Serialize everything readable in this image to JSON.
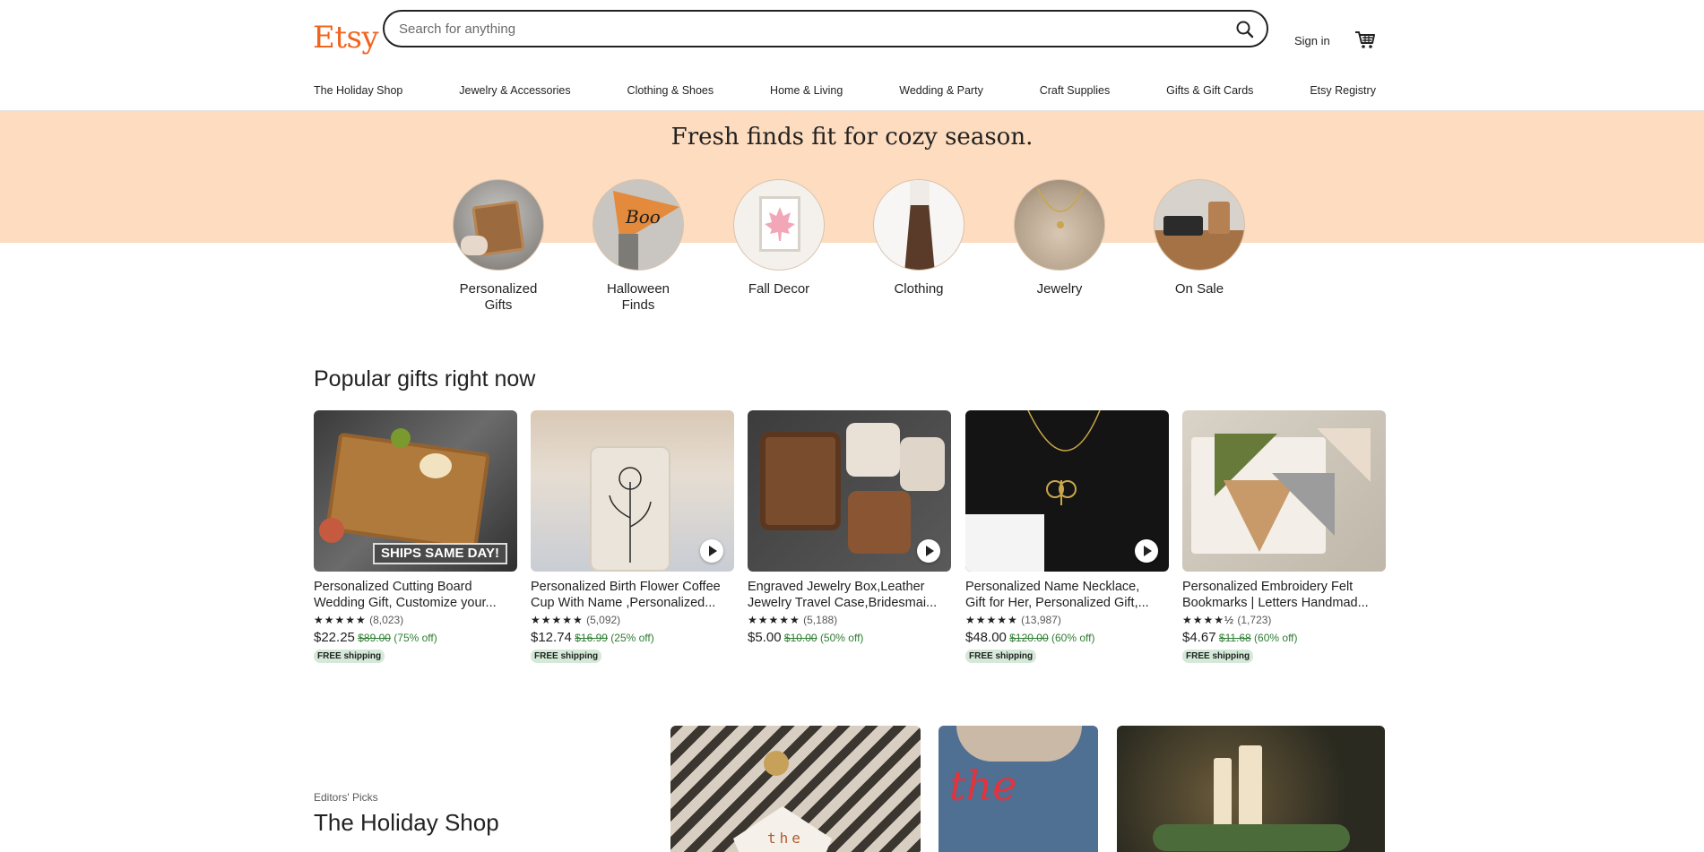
{
  "header": {
    "logo": "Etsy",
    "search_placeholder": "Search for anything",
    "sign_in": "Sign in",
    "nav": [
      "The Holiday Shop",
      "Jewelry & Accessories",
      "Clothing & Shoes",
      "Home & Living",
      "Wedding & Party",
      "Craft Supplies",
      "Gifts & Gift Cards",
      "Etsy Registry"
    ]
  },
  "hero": {
    "title": "Fresh finds fit for cozy season.",
    "categories": [
      {
        "label": "Personalized Gifts",
        "line1": "Personalized",
        "line2": "Gifts"
      },
      {
        "label": "Halloween Finds",
        "line1": "Halloween",
        "line2": "Finds"
      },
      {
        "label": "Fall Decor",
        "line1": "Fall Decor",
        "line2": ""
      },
      {
        "label": "Clothing",
        "line1": "Clothing",
        "line2": ""
      },
      {
        "label": "Jewelry",
        "line1": "Jewelry",
        "line2": ""
      },
      {
        "label": "On Sale",
        "line1": "On Sale",
        "line2": ""
      }
    ],
    "pennant_text": "Boo"
  },
  "popular": {
    "title": "Popular gifts right now",
    "products": [
      {
        "title_line1": "Personalized Cutting Board",
        "title_line2": "Wedding Gift, Customize your...",
        "stars": "★★★★★",
        "reviews": "(8,023)",
        "price": "$22.25",
        "original": "$89.00",
        "discount": "(75% off)",
        "badge": "FREE shipping",
        "overlay": "SHIPS SAME DAY!"
      },
      {
        "title_line1": "Personalized Birth Flower Coffee",
        "title_line2": "Cup With Name ,Personalized...",
        "stars": "★★★★★",
        "reviews": "(5,092)",
        "price": "$12.74",
        "original": "$16.99",
        "discount": "(25% off)",
        "badge": "FREE shipping"
      },
      {
        "title_line1": "Engraved Jewelry Box,Leather",
        "title_line2": "Jewelry Travel Case,Bridesmai...",
        "stars": "★★★★★",
        "reviews": "(5,188)",
        "price": "$5.00",
        "original": "$10.00",
        "discount": "(50% off)",
        "badge": ""
      },
      {
        "title_line1": "Personalized Name Necklace,",
        "title_line2": "Gift for Her, Personalized Gift,...",
        "stars": "★★★★★",
        "reviews": "(13,987)",
        "price": "$48.00",
        "original": "$120.00",
        "discount": "(60% off)",
        "badge": "FREE shipping"
      },
      {
        "title_line1": "Personalized Embroidery Felt",
        "title_line2": "Bookmarks | Letters Handmad...",
        "stars": "★★★★½",
        "reviews": "(1,723)",
        "price": "$4.67",
        "original": "$11.68",
        "discount": "(60% off)",
        "badge": "FREE shipping"
      }
    ]
  },
  "editors": {
    "eyebrow": "Editors' Picks",
    "title": "The Holiday Shop",
    "ornament_text": "the",
    "sign_text": "the"
  },
  "colors": {
    "brand": "#f1641e",
    "hero_bg": "#fddcbf",
    "sale_green": "#2f7d32",
    "badge_bg": "#d4e9d7"
  }
}
